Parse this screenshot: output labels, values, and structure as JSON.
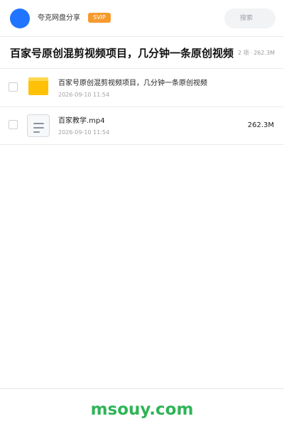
{
  "header": {
    "app_name": "夸克网盘分享",
    "badge": "SVIP",
    "search_placeholder": "搜索"
  },
  "share": {
    "title": "百家号原创混剪视频项目，几分钟一条原创视频",
    "item_count": "2 项",
    "separator": "·",
    "total_size": "262.3M"
  },
  "files": [
    {
      "name": "百家号原创混剪视频项目，几分钟一条原创视频",
      "date": "2026-09-10 11:54",
      "size": "",
      "icon": "folder-icon"
    },
    {
      "name": "百家教学.mp4",
      "date": "2026-09-10 11:54",
      "size": "262.3M",
      "icon": "document-icon"
    }
  ],
  "footer": {
    "watermark": "msouy.com"
  },
  "colors": {
    "avatar": "#1f75ff",
    "badge": "#f79a2e",
    "folder": "#ffc107",
    "watermark": "#2fb457"
  }
}
